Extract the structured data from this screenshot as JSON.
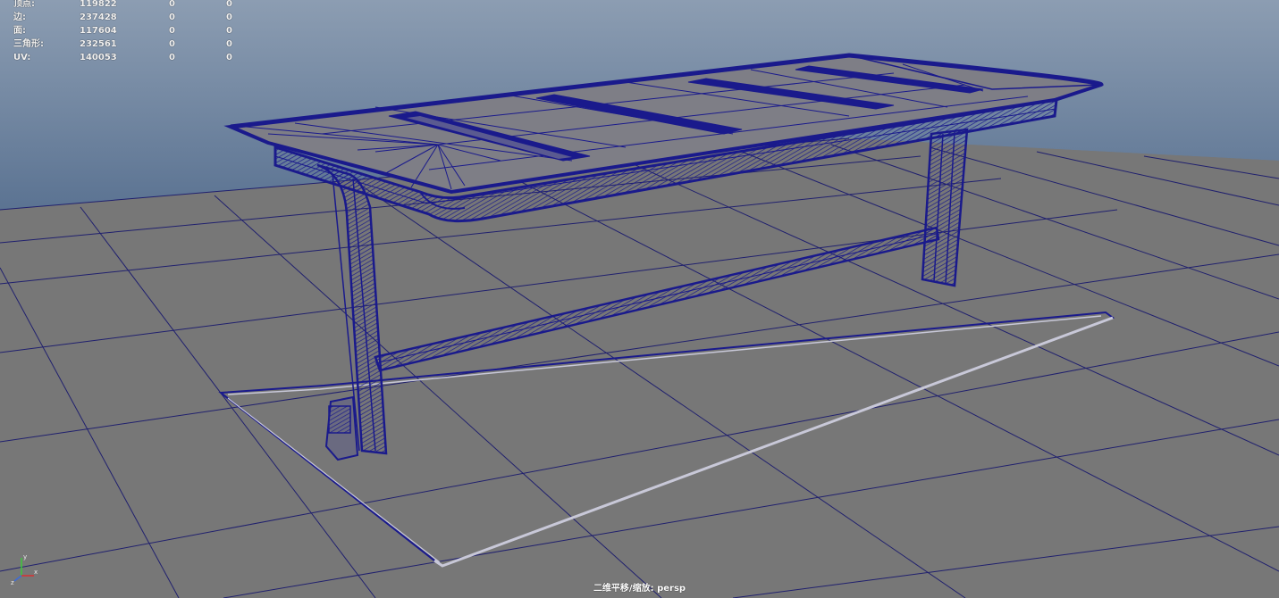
{
  "stats": [
    {
      "label": "顶点:",
      "v1": "119822",
      "v2": "0",
      "v3": "0"
    },
    {
      "label": "边:",
      "v1": "237428",
      "v2": "0",
      "v3": "0"
    },
    {
      "label": "面:",
      "v1": "117604",
      "v2": "0",
      "v3": "0"
    },
    {
      "label": "三角形:",
      "v1": "232561",
      "v2": "0",
      "v3": "0"
    },
    {
      "label": "UV:",
      "v1": "140053",
      "v2": "0",
      "v3": "0"
    }
  ],
  "camera_label": "二维平移/缩放: persp",
  "colors": {
    "sky_top": "#8a9bb0",
    "sky_bottom": "#5d7594",
    "ground": "#777777",
    "grid": "#1c1c6b",
    "wire": "#1a1a8c",
    "hud_text": "#f2f2f2"
  },
  "axis_gizmo": {
    "x": "x",
    "y": "y",
    "z": "z"
  }
}
